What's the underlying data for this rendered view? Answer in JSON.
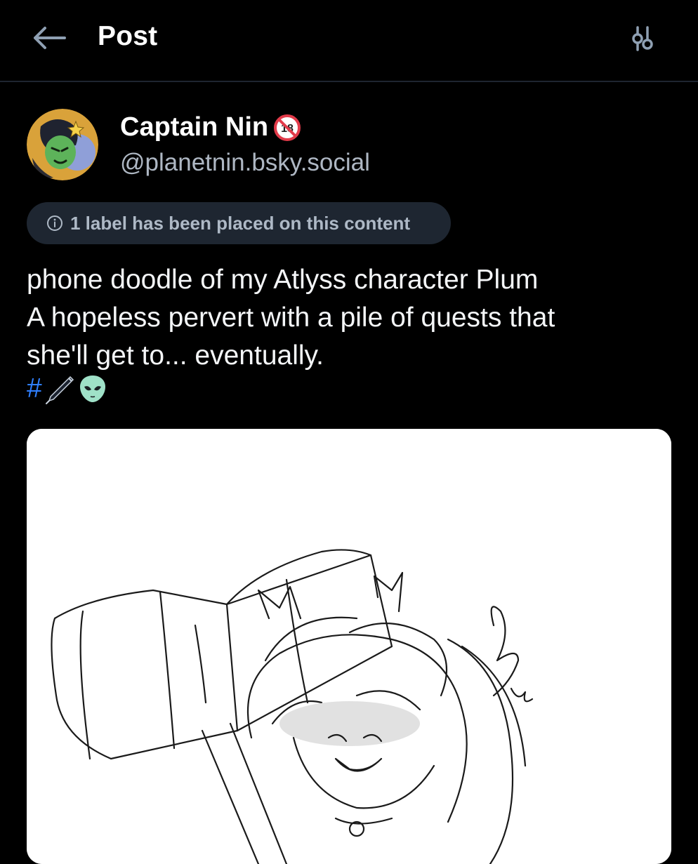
{
  "header": {
    "title": "Post",
    "back_icon": "arrow-left-icon",
    "settings_icon": "sliders-icon"
  },
  "author": {
    "display_name": "Captain Nin",
    "badge_icon": "no-under-18-icon",
    "handle": "@planetnin.bsky.social",
    "avatar_icon": "avatar-image"
  },
  "label_notice": {
    "icon": "info-circle-icon",
    "text": "1 label has been placed on this content"
  },
  "post": {
    "lines": [
      "phone doodle of my Atlyss character Plum",
      "A hopeless pervert with a pile of quests that",
      "she'll get to... eventually."
    ],
    "hashtag_prefix": "#",
    "hashtag_emoji": [
      "pen-icon",
      "alien-icon"
    ]
  },
  "colors": {
    "background": "#000000",
    "divider": "#1e2530",
    "label_pill": "#1e2631",
    "hashtag": "#2f7fff",
    "handle": "#aeb7c3"
  }
}
